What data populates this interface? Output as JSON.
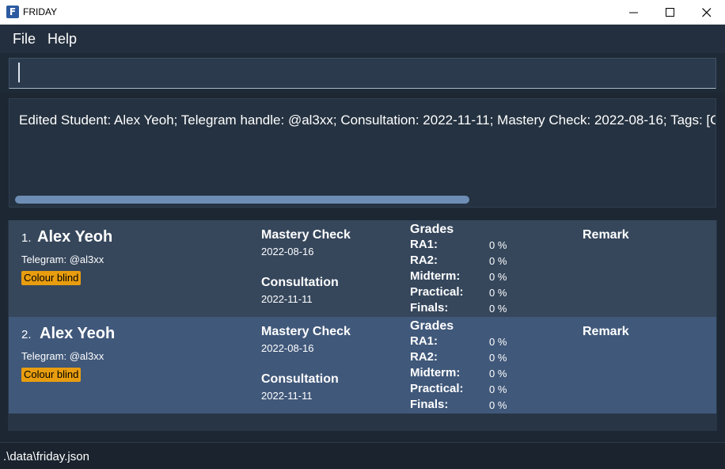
{
  "window": {
    "title": "FRIDAY",
    "icon_letter": "F"
  },
  "menu": {
    "file": "File",
    "help": "Help"
  },
  "command": {
    "value": ""
  },
  "result": {
    "text": "Edited Student: Alex Yeoh; Telegram handle: @al3xx; Consultation: 2022-11-11; Mastery Check: 2022-08-16; Tags: [Colour blind]"
  },
  "labels": {
    "mastery": "Mastery Check",
    "consultation": "Consultation",
    "grades": "Grades",
    "remark": "Remark",
    "ra1": "RA1:",
    "ra2": "RA2:",
    "midterm": "Midterm:",
    "practical": "Practical:",
    "finals": "Finals:"
  },
  "students": [
    {
      "index": "1.",
      "name": "Alex Yeoh",
      "telegram": "Telegram: @al3xx",
      "tag": "Colour blind",
      "mastery": "2022-08-16",
      "consultation": "2022-11-11",
      "grades": {
        "ra1": "0 %",
        "ra2": "0 %",
        "midterm": "0 %",
        "practical": "0 %",
        "finals": "0 %"
      }
    },
    {
      "index": "2.",
      "name": "Alex Yeoh",
      "telegram": "Telegram: @al3xx",
      "tag": "Colour blind",
      "mastery": "2022-08-16",
      "consultation": "2022-11-11",
      "grades": {
        "ra1": "0 %",
        "ra2": "0 %",
        "midterm": "0 %",
        "practical": "0 %",
        "finals": "0 %"
      }
    }
  ],
  "status": {
    "path": ".\\data\\friday.json"
  },
  "colors": {
    "tag": "#e89d0f",
    "card1": "#36475c",
    "card2_selected": "#40587a",
    "scrollbar": "#6d8db5"
  }
}
